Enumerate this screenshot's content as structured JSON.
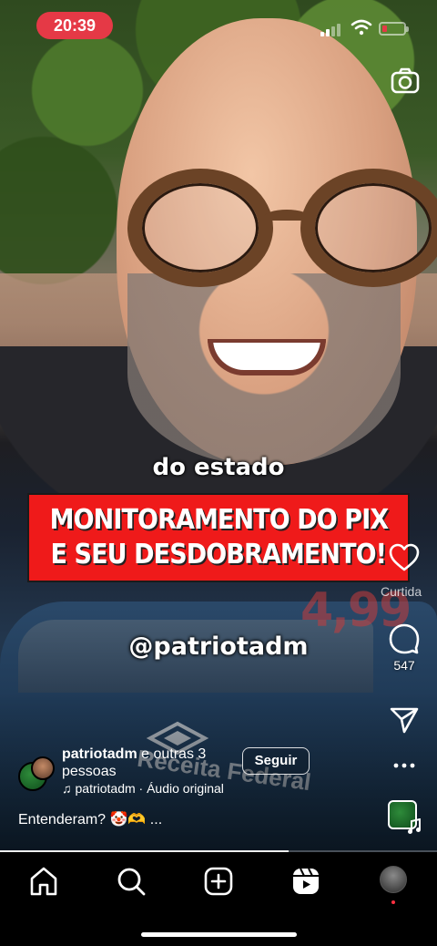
{
  "status_bar": {
    "time": "20:39",
    "battery_color": "#e53946"
  },
  "video": {
    "caption_small": "do estado",
    "banner_line1": "MONITORAMENTO DO PIX",
    "banner_line2": "E SEU DESDOBRAMENTO!",
    "banner_color": "#ef1a1a",
    "overlay_handle": "@patriotadm",
    "background_price": "4,99"
  },
  "actions": {
    "like_label": "Curtida",
    "comment_count": "547",
    "like_icon": "heart-icon",
    "comment_icon": "comment-icon",
    "share_icon": "send-icon",
    "more_icon": "more-icon"
  },
  "post": {
    "author": "patriotadm",
    "coauthors": "e outras 3 pessoas",
    "follow_label": "Seguir",
    "audio_label": "patriotadm · Áudio original",
    "description": "Entenderam? 🤡🫶 ..."
  },
  "progress": {
    "fraction": 0.66
  },
  "nav": {
    "items": [
      "home-icon",
      "search-icon",
      "create-icon",
      "reels-icon",
      "profile-avatar"
    ]
  }
}
